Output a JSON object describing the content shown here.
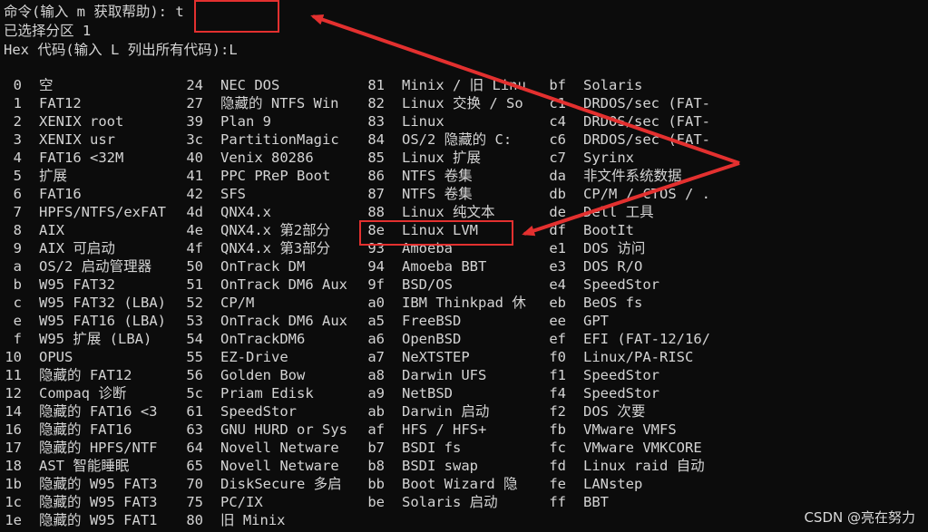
{
  "prompt": {
    "command_label": "命令(输入 m 获取帮助):",
    "command_input": "t",
    "selected_partition": "已选择分区 1",
    "hex_prompt": "Hex 代码(输入 L 列出所有代码):L"
  },
  "partition_types": {
    "col1": [
      {
        "code": "0",
        "name": "空"
      },
      {
        "code": "1",
        "name": "FAT12"
      },
      {
        "code": "2",
        "name": "XENIX root"
      },
      {
        "code": "3",
        "name": "XENIX usr"
      },
      {
        "code": "4",
        "name": "FAT16 <32M"
      },
      {
        "code": "5",
        "name": "扩展"
      },
      {
        "code": "6",
        "name": "FAT16"
      },
      {
        "code": "7",
        "name": "HPFS/NTFS/exFAT"
      },
      {
        "code": "8",
        "name": "AIX"
      },
      {
        "code": "9",
        "name": "AIX 可启动"
      },
      {
        "code": "a",
        "name": "OS/2 启动管理器"
      },
      {
        "code": "b",
        "name": "W95 FAT32"
      },
      {
        "code": "c",
        "name": "W95 FAT32 (LBA)"
      },
      {
        "code": "e",
        "name": "W95 FAT16 (LBA)"
      },
      {
        "code": "f",
        "name": "W95 扩展 (LBA)"
      },
      {
        "code": "10",
        "name": "OPUS"
      },
      {
        "code": "11",
        "name": "隐藏的 FAT12"
      },
      {
        "code": "12",
        "name": "Compaq 诊断"
      },
      {
        "code": "14",
        "name": "隐藏的 FAT16 <3"
      },
      {
        "code": "16",
        "name": "隐藏的 FAT16"
      },
      {
        "code": "17",
        "name": "隐藏的 HPFS/NTF"
      },
      {
        "code": "18",
        "name": "AST 智能睡眠"
      },
      {
        "code": "1b",
        "name": "隐藏的 W95 FAT3"
      },
      {
        "code": "1c",
        "name": "隐藏的 W95 FAT3"
      },
      {
        "code": "1e",
        "name": "隐藏的 W95 FAT1"
      }
    ],
    "col2": [
      {
        "code": "24",
        "name": "NEC DOS"
      },
      {
        "code": "27",
        "name": "隐藏的 NTFS Win"
      },
      {
        "code": "39",
        "name": "Plan 9"
      },
      {
        "code": "3c",
        "name": "PartitionMagic"
      },
      {
        "code": "40",
        "name": "Venix 80286"
      },
      {
        "code": "41",
        "name": "PPC PReP Boot"
      },
      {
        "code": "42",
        "name": "SFS"
      },
      {
        "code": "4d",
        "name": "QNX4.x"
      },
      {
        "code": "4e",
        "name": "QNX4.x 第2部分"
      },
      {
        "code": "4f",
        "name": "QNX4.x 第3部分"
      },
      {
        "code": "50",
        "name": "OnTrack DM"
      },
      {
        "code": "51",
        "name": "OnTrack DM6 Aux"
      },
      {
        "code": "52",
        "name": "CP/M"
      },
      {
        "code": "53",
        "name": "OnTrack DM6 Aux"
      },
      {
        "code": "54",
        "name": "OnTrackDM6"
      },
      {
        "code": "55",
        "name": "EZ-Drive"
      },
      {
        "code": "56",
        "name": "Golden Bow"
      },
      {
        "code": "5c",
        "name": "Priam Edisk"
      },
      {
        "code": "61",
        "name": "SpeedStor"
      },
      {
        "code": "63",
        "name": "GNU HURD or Sys"
      },
      {
        "code": "64",
        "name": "Novell Netware"
      },
      {
        "code": "65",
        "name": "Novell Netware"
      },
      {
        "code": "70",
        "name": "DiskSecure 多启"
      },
      {
        "code": "75",
        "name": "PC/IX"
      },
      {
        "code": "80",
        "name": "旧 Minix"
      }
    ],
    "col3": [
      {
        "code": "81",
        "name": "Minix / 旧 Linu"
      },
      {
        "code": "82",
        "name": "Linux 交换 / So"
      },
      {
        "code": "83",
        "name": "Linux"
      },
      {
        "code": "84",
        "name": "OS/2 隐藏的 C:"
      },
      {
        "code": "85",
        "name": "Linux 扩展"
      },
      {
        "code": "86",
        "name": "NTFS 卷集"
      },
      {
        "code": "87",
        "name": "NTFS 卷集"
      },
      {
        "code": "88",
        "name": "Linux 纯文本"
      },
      {
        "code": "8e",
        "name": "Linux LVM"
      },
      {
        "code": "93",
        "name": "Amoeba"
      },
      {
        "code": "94",
        "name": "Amoeba BBT"
      },
      {
        "code": "9f",
        "name": "BSD/OS"
      },
      {
        "code": "a0",
        "name": "IBM Thinkpad 休"
      },
      {
        "code": "a5",
        "name": "FreeBSD"
      },
      {
        "code": "a6",
        "name": "OpenBSD"
      },
      {
        "code": "a7",
        "name": "NeXTSTEP"
      },
      {
        "code": "a8",
        "name": "Darwin UFS"
      },
      {
        "code": "a9",
        "name": "NetBSD"
      },
      {
        "code": "ab",
        "name": "Darwin 启动"
      },
      {
        "code": "af",
        "name": "HFS / HFS+"
      },
      {
        "code": "b7",
        "name": "BSDI fs"
      },
      {
        "code": "b8",
        "name": "BSDI swap"
      },
      {
        "code": "bb",
        "name": "Boot Wizard 隐"
      },
      {
        "code": "be",
        "name": "Solaris 启动"
      }
    ],
    "col4": [
      {
        "code": "bf",
        "name": "Solaris"
      },
      {
        "code": "c1",
        "name": "DRDOS/sec (FAT-"
      },
      {
        "code": "c4",
        "name": "DRDOS/sec (FAT-"
      },
      {
        "code": "c6",
        "name": "DRDOS/sec (FAT-"
      },
      {
        "code": "c7",
        "name": "Syrinx"
      },
      {
        "code": "da",
        "name": "非文件系统数据"
      },
      {
        "code": "db",
        "name": "CP/M / CTOS / ."
      },
      {
        "code": "de",
        "name": "Dell 工具"
      },
      {
        "code": "df",
        "name": "BootIt"
      },
      {
        "code": "e1",
        "name": "DOS 访问"
      },
      {
        "code": "e3",
        "name": "DOS R/O"
      },
      {
        "code": "e4",
        "name": "SpeedStor"
      },
      {
        "code": "eb",
        "name": "BeOS fs"
      },
      {
        "code": "ee",
        "name": "GPT"
      },
      {
        "code": "ef",
        "name": "EFI (FAT-12/16/"
      },
      {
        "code": "f0",
        "name": "Linux/PA-RISC"
      },
      {
        "code": "f1",
        "name": "SpeedStor"
      },
      {
        "code": "f4",
        "name": "SpeedStor"
      },
      {
        "code": "f2",
        "name": "DOS 次要"
      },
      {
        "code": "fb",
        "name": "VMware VMFS"
      },
      {
        "code": "fc",
        "name": "VMware VMKCORE"
      },
      {
        "code": "fd",
        "name": "Linux raid 自动"
      },
      {
        "code": "fe",
        "name": "LANstep"
      },
      {
        "code": "ff",
        "name": "BBT"
      }
    ]
  },
  "watermark": "CSDN @亮在努力",
  "colors": {
    "background": "#0c0c0c",
    "text": "#d4d4d4",
    "annotation": "#e3302f"
  }
}
